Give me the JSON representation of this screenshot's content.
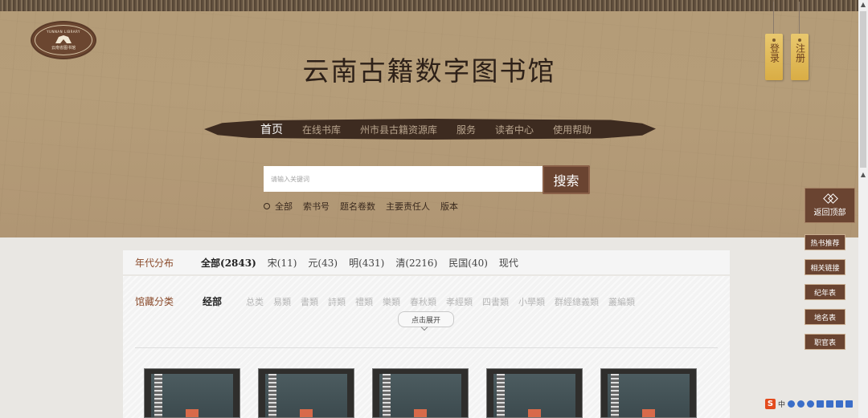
{
  "header": {
    "logo_en": "YUNNAN LIBRARY",
    "logo_cn": "云南省图书馆",
    "title": "云南古籍数字图书馆",
    "login": "登录",
    "register": "注册"
  },
  "nav": {
    "items": [
      "首页",
      "在线书库",
      "州市县古籍资源库",
      "服务",
      "读者中心",
      "使用帮助"
    ]
  },
  "search": {
    "placeholder": "请输入关键词",
    "button": "搜索",
    "options": [
      "全部",
      "索书号",
      "题名卷数",
      "主要责任人",
      "版本"
    ]
  },
  "filter": {
    "era_label": "年代分布",
    "eras": [
      "全部(2843)",
      "宋(11)",
      "元(43)",
      "明(431)",
      "清(2216)",
      "民国(40)",
      "现代"
    ],
    "category_label": "馆藏分类",
    "category_active": "经部",
    "categories": [
      "总类",
      "易類",
      "書類",
      "詩類",
      "禮類",
      "樂類",
      "春秋類",
      "孝經類",
      "四書類",
      "小學類",
      "群經總義類",
      "叢編類"
    ],
    "expand": "点击展开"
  },
  "side": {
    "back_top": "返回顶部",
    "buttons": [
      "热书推荐",
      "相关链接",
      "纪年表",
      "地名表",
      "职官表"
    ]
  },
  "tray": {
    "text": "中"
  },
  "colors": {
    "header_bg": "#b49c78",
    "accent_brown": "#6a4431",
    "nav_bg": "#3d2b20",
    "tag_gold": "#e0bb5c"
  }
}
